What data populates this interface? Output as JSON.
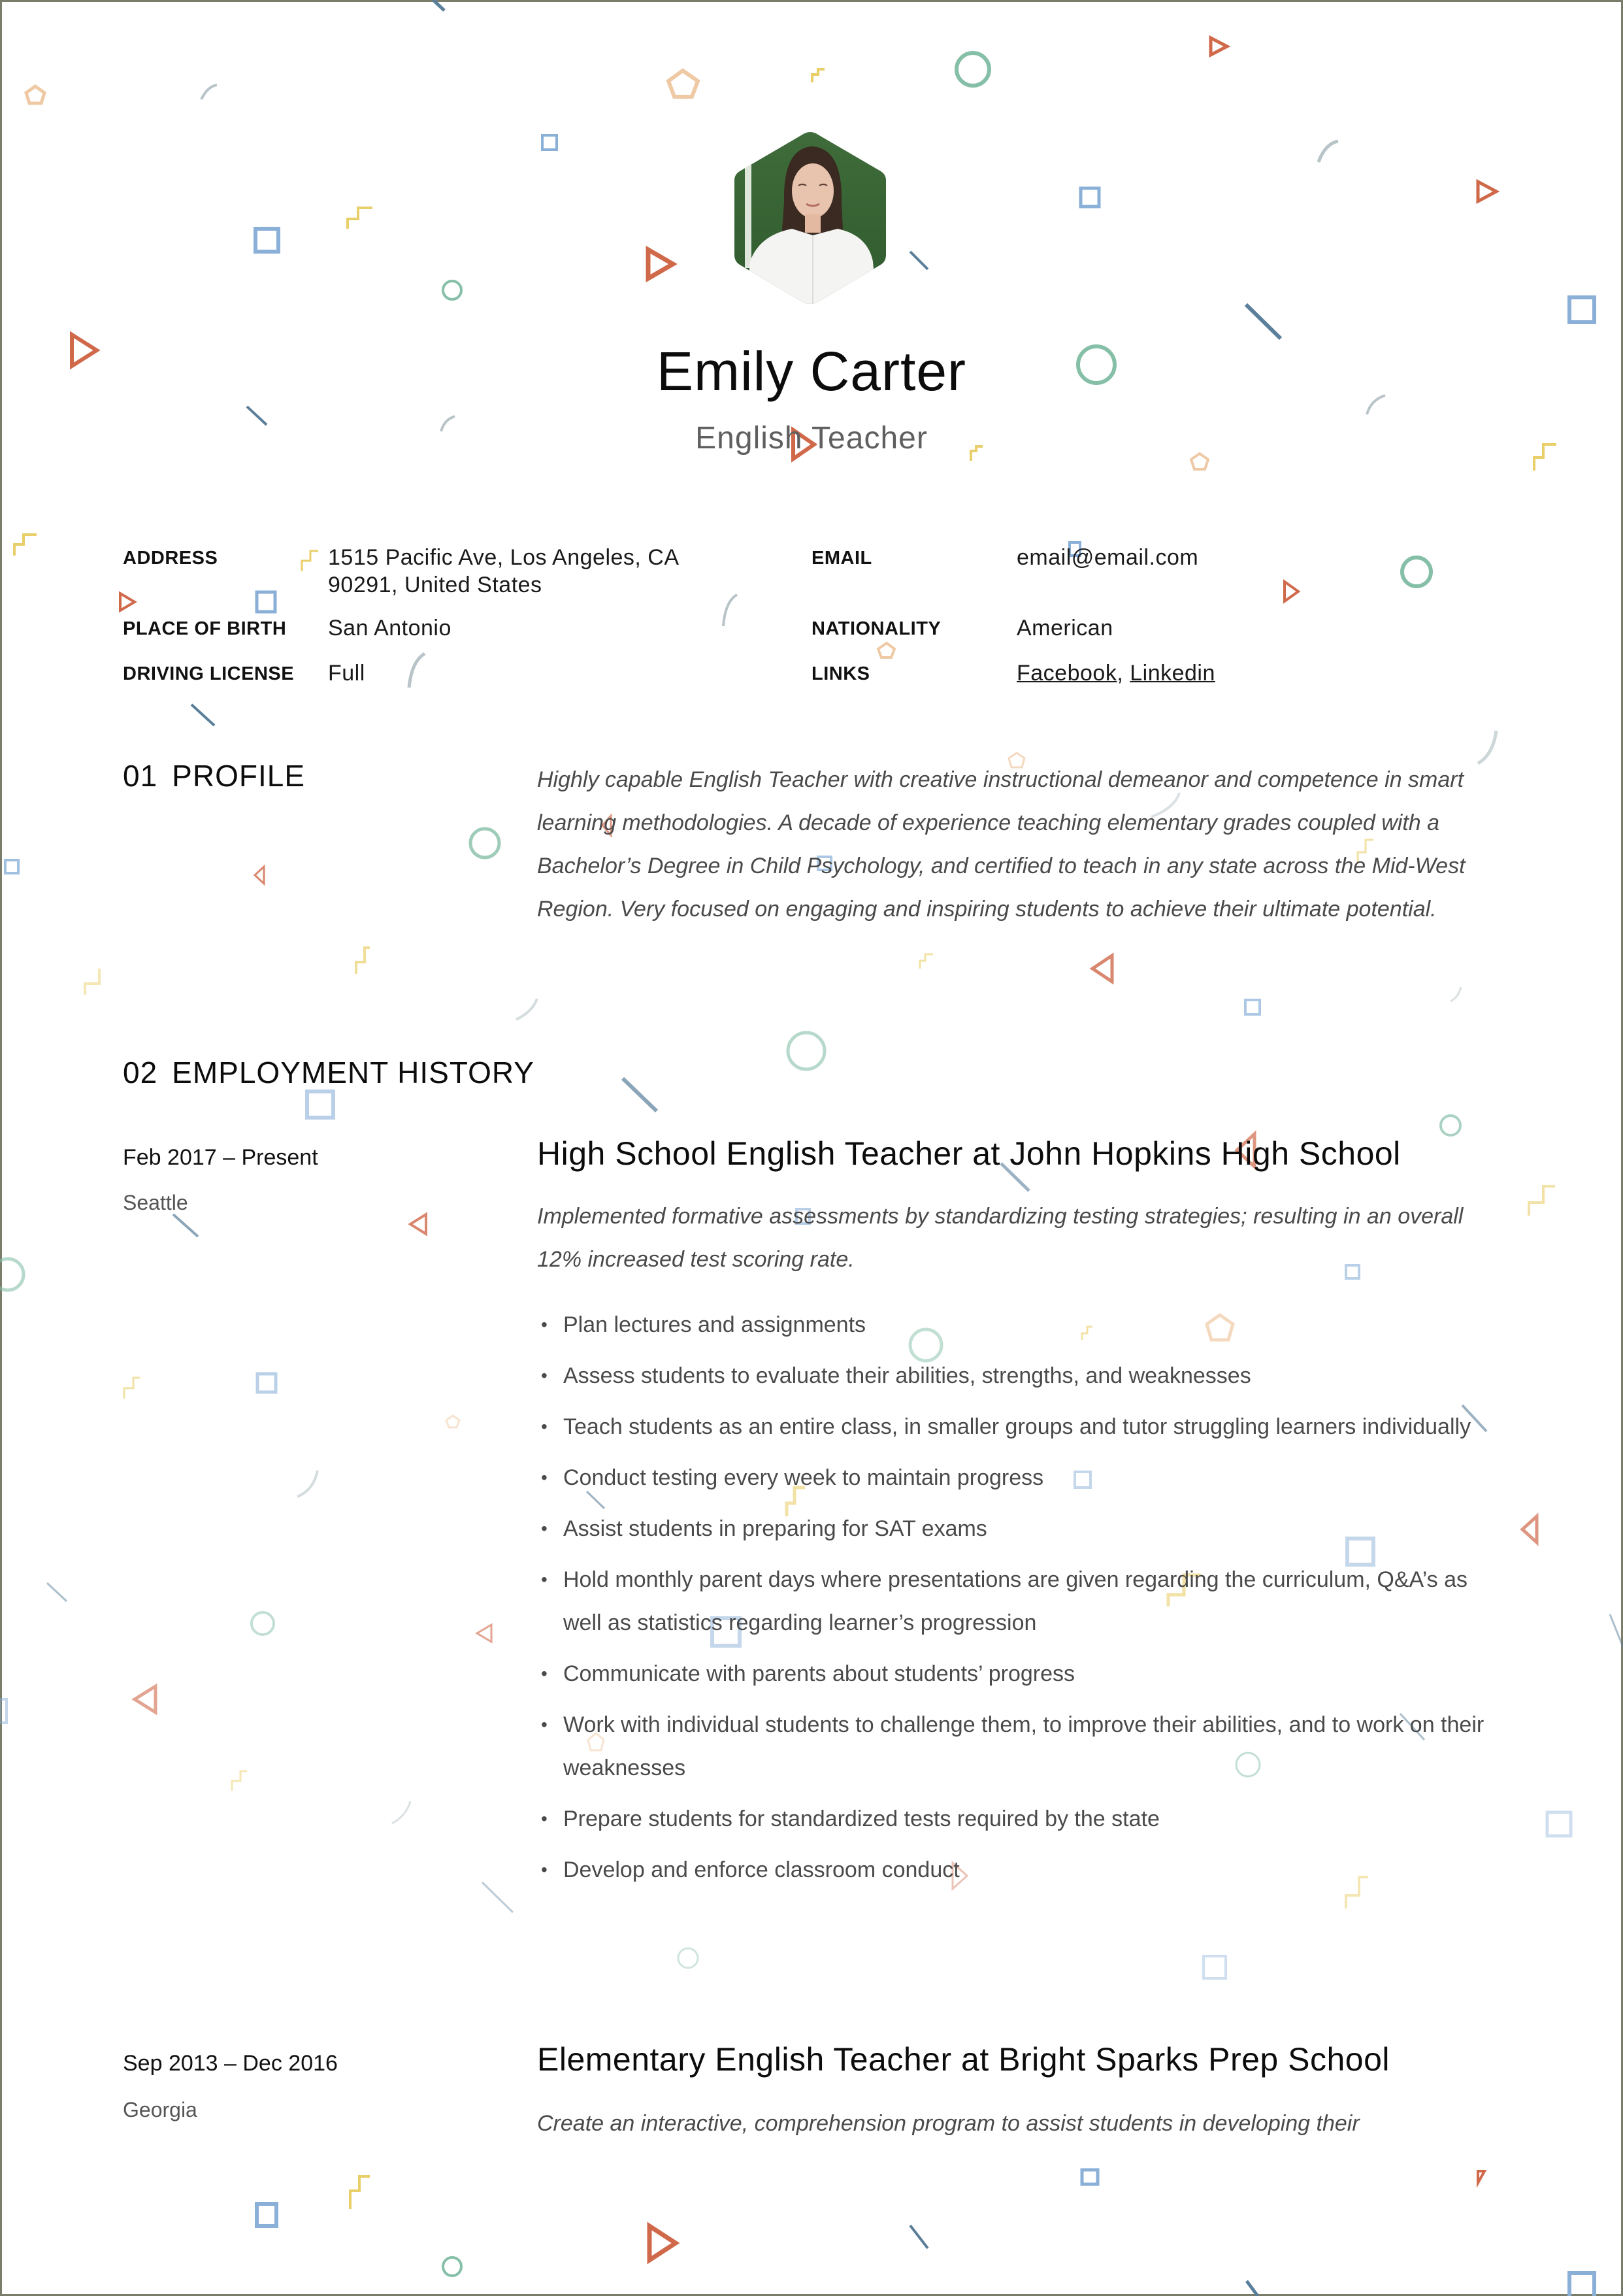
{
  "header": {
    "name": "Emily Carter",
    "title": "English Teacher",
    "photo_alt": "Portrait photo of Emily Carter"
  },
  "contact": {
    "left": [
      {
        "label": "ADDRESS",
        "value_line1": "1515 Pacific Ave, Los Angeles, CA",
        "value_line2": "90291, United States"
      },
      {
        "label": "PLACE OF BIRTH",
        "value": "San Antonio"
      },
      {
        "label": "DRIVING LICENSE",
        "value": "Full"
      }
    ],
    "right": [
      {
        "label": "EMAIL",
        "value": "email@email.com"
      },
      {
        "label": "NATIONALITY",
        "value": "American"
      },
      {
        "label": "LINKS",
        "links": [
          "Facebook",
          "Linkedin"
        ],
        "separator": ","
      }
    ]
  },
  "sections": {
    "profile": {
      "number": "01",
      "heading": "PROFILE",
      "text": "Highly capable English Teacher with creative instructional demeanor and competence in smart learning methodologies. A decade of experience teaching elementary grades coupled with a Bachelor’s Degree in Child Psychology, and certified to teach in any state across the Mid-West Region. Very focused on engaging and inspiring students to achieve their ultimate potential."
    },
    "employment": {
      "number": "02",
      "heading": "EMPLOYMENT HISTORY",
      "jobs": [
        {
          "dates": "Feb 2017 – Present",
          "location": "Seattle",
          "title": "High School English Teacher at John Hopkins High School",
          "summary": "Implemented formative assessments by standardizing testing strategies; resulting in an overall 12% increased test scoring rate.",
          "bullets": [
            "Plan lectures and assignments",
            "Assess students to evaluate their abilities, strengths, and weaknesses",
            "Teach students as an entire class, in smaller groups and tutor struggling learners individually",
            "Conduct testing every week to maintain progress",
            "Assist students in preparing for SAT exams",
            "Hold monthly parent days where presentations are given regarding the curriculum, Q&A’s as well as statistics regarding learner’s progression",
            "Communicate with parents about students’ progress",
            "Work with individual students to challenge them, to improve their abilities, and to work on their weaknesses",
            "Prepare students for standardized tests required by the state",
            "Develop and enforce classroom conduct"
          ]
        },
        {
          "dates": "Sep 2013 – Dec 2016",
          "location": "Georgia",
          "title": "Elementary English Teacher at Bright Sparks Prep School",
          "summary": "Create an interactive, comprehension program to assist students in developing their"
        }
      ]
    }
  },
  "theme": {
    "frame": "#7a7d6a",
    "coral": "#d0694a",
    "teal": "#86bfa8",
    "blue": "#8ab0d8",
    "peach": "#efc9a4",
    "yellow": "#e9cf6a",
    "slate": "#5a7f9a",
    "arc": "#b8c4c8"
  }
}
